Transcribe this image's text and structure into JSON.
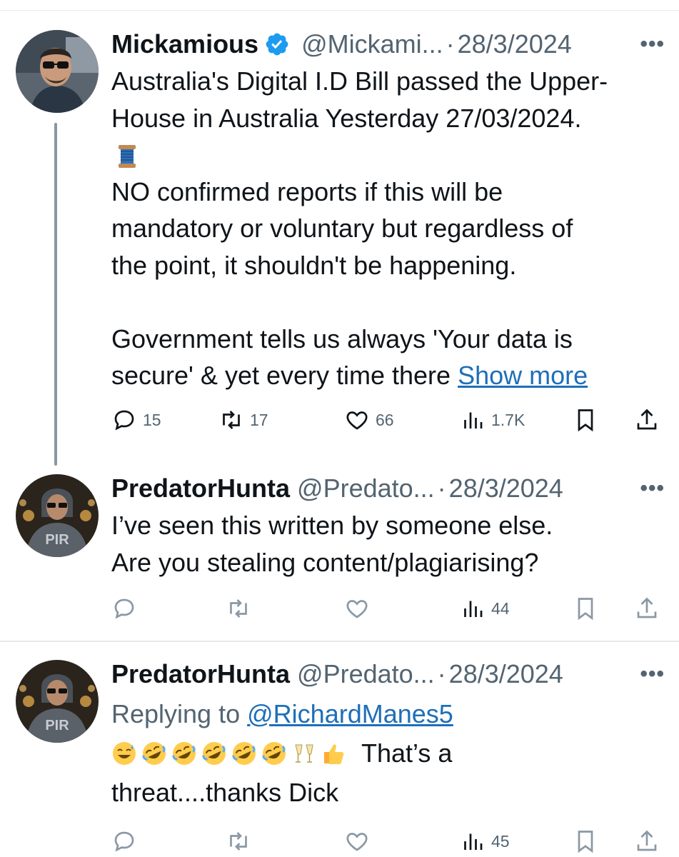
{
  "tweets": [
    {
      "name": "Mickamious",
      "handle": "@Mickami...",
      "dot": "·",
      "date": "28/3/2024",
      "lines": [
        "Australia's Digital I.D Bill passed the Upper-",
        "House in Australia Yesterday 27/03/2024."
      ],
      "lines2": [
        "NO confirmed reports if this will be",
        "mandatory or voluntary but regardless of",
        "the point, it shouldn't be happening."
      ],
      "lines3": [
        "Government tells us always 'Your data is",
        "secure' & yet every time there"
      ],
      "show_more": "Show more",
      "replies": "15",
      "retweets": "17",
      "likes": "66",
      "views": "1.7K"
    },
    {
      "name": "PredatorHunta",
      "handle": "@Predato...",
      "dot": "·",
      "date": "28/3/2024",
      "lines": [
        "I’ve seen this written by someone else.",
        "Are you stealing content/plagiarising?"
      ],
      "views": "44"
    },
    {
      "name": "PredatorHunta",
      "handle": "@Predato...",
      "dot": "·",
      "date": "28/3/2024",
      "replying_prefix": "Replying to",
      "replying_to": "@RichardManes5",
      "text_after_emoji": "That’s a",
      "line2": "threat....thanks Dick",
      "views": "45"
    }
  ],
  "icons": {
    "more": "more-icon",
    "reply": "reply-icon",
    "retweet": "retweet-icon",
    "like": "like-icon",
    "views": "views-icon",
    "bookmark": "bookmark-icon",
    "share": "share-icon"
  },
  "colors": {
    "verified": "#1d9bf0",
    "link": "#1d6fb8",
    "muted": "#536471",
    "thread_line": "#8a96a3"
  }
}
